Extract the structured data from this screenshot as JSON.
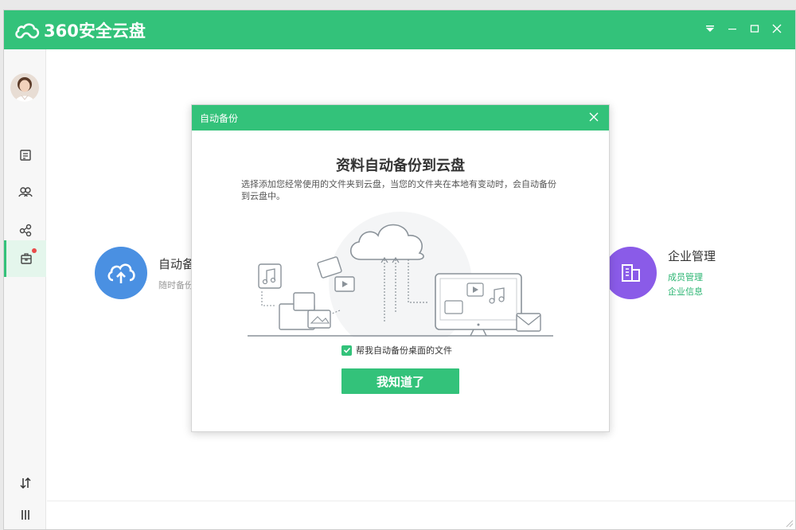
{
  "app": {
    "title": "360安全云盘"
  },
  "window_controls": [
    "menu-down-icon",
    "minimize-icon",
    "maximize-icon",
    "close-icon"
  ],
  "sidebar": {
    "items": [
      {
        "name": "document-icon"
      },
      {
        "name": "group-icon"
      },
      {
        "name": "share-icon"
      },
      {
        "name": "toolbox-icon",
        "active": true,
        "badge": true
      }
    ],
    "bottom": [
      {
        "name": "transfer-icon"
      },
      {
        "name": "menu-icon"
      }
    ]
  },
  "features": {
    "auto_backup": {
      "title": "自动备",
      "sub": "随时备份"
    },
    "enterprise": {
      "title": "企业管理",
      "links": [
        "成员管理",
        "企业信息"
      ]
    }
  },
  "dialog": {
    "header": "自动备份",
    "title": "资料自动备份到云盘",
    "desc": "选择添加您经常使用的文件夹到云盘，当您的文件夹在本地有变动时，会自动备份到云盘中。",
    "checkbox_label": "帮我自动备份桌面的文件",
    "checkbox_checked": true,
    "confirm": "我知道了"
  },
  "colors": {
    "brand": "#33c27a",
    "blue": "#4a90e2",
    "purple": "#8a5be8",
    "badge": "#e94b4b"
  }
}
